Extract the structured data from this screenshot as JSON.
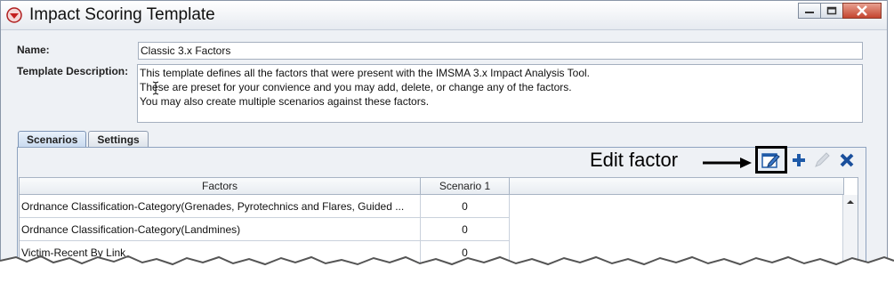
{
  "window": {
    "title": "Impact Scoring Template",
    "controls": [
      "minimize-icon",
      "maximize-icon",
      "close-icon"
    ]
  },
  "form": {
    "name_label": "Name:",
    "name_value": "Classic 3.x Factors",
    "desc_label": "Template Description:",
    "desc_lines": [
      "This template defines all the factors that were present with the IMSMA 3.x Impact Analysis Tool.",
      "These are preset for your convience and you may add, delete, or change any of the factors.",
      "You may also create multiple scenarios against these factors."
    ]
  },
  "tabs": [
    {
      "label": "Scenarios",
      "active": true
    },
    {
      "label": "Settings",
      "active": false
    }
  ],
  "annotation": {
    "text": "Edit factor"
  },
  "toolbar": {
    "buttons": [
      "edit-factor-icon",
      "add-icon",
      "pencil-icon",
      "delete-icon"
    ]
  },
  "table": {
    "columns": [
      "Factors",
      "Scenario 1"
    ],
    "rows": [
      {
        "factor": "Ordnance Classification-Category(Grenades, Pyrotechnics and Flares, Guided ...",
        "scenario1": "0"
      },
      {
        "factor": "Ordnance Classification-Category(Landmines)",
        "scenario1": "0"
      },
      {
        "factor": "Victim-Recent By Link",
        "scenario1": "0"
      }
    ]
  },
  "colors": {
    "accent": "#1e5aa8",
    "delete": "#1a4f9c"
  }
}
